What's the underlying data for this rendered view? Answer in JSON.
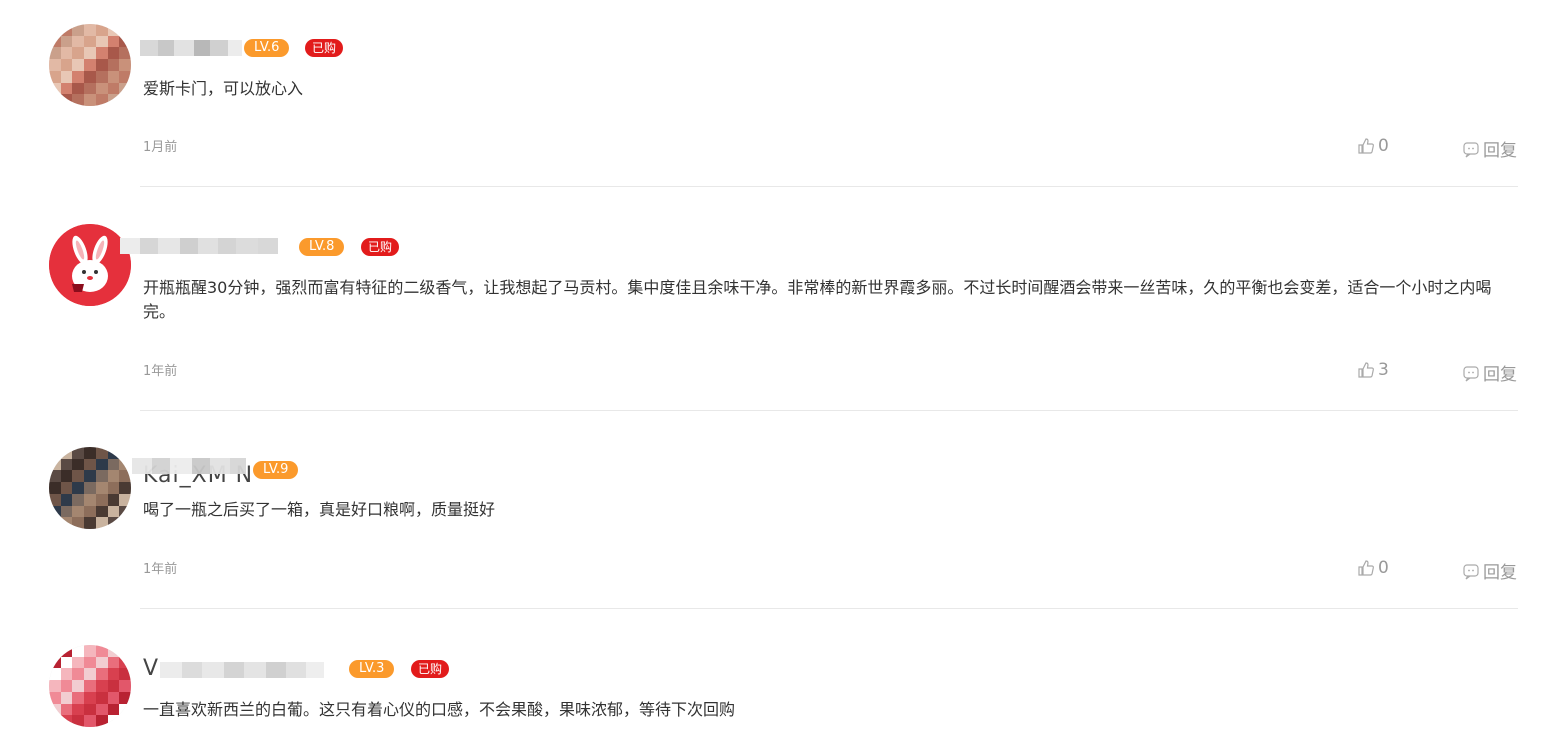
{
  "colors": {
    "level_badge": "#fb9a2c",
    "bought_badge": "#e21b1b",
    "meta_text": "#999999",
    "divider": "#e8e8e8"
  },
  "comments": [
    {
      "level": "LV.6",
      "bought": "已购",
      "text": "爱斯卡门，可以放心入",
      "time": "1月前",
      "likes": "0",
      "reply": "回复",
      "avatar_icon": "blurred-avatar-icon"
    },
    {
      "level": "LV.8",
      "bought": "已购",
      "text": "开瓶瓶醒30分钟，强烈而富有特征的二级香气，让我想起了马贡村。集中度佳且余味干净。非常棒的新世界霞多丽。不过长时间醒酒会带来一丝苦味，久的平衡也会变差，适合一个小时之内喝完。",
      "time": "1年前",
      "likes": "3",
      "reply": "回复",
      "avatar_icon": "rabbit-wine-avatar-icon"
    },
    {
      "name_partial": "Kai_XM N",
      "level": "LV.9",
      "text": "喝了一瓶之后买了一箱，真是好口粮啊，质量挺好",
      "time": "1年前",
      "likes": "0",
      "reply": "回复",
      "avatar_icon": "blurred-avatar-icon"
    },
    {
      "name_partial": "V",
      "level": "LV.3",
      "bought": "已购",
      "text": "一直喜欢新西兰的白葡。这只有着心仪的口感，不会果酸，果味浓郁，等待下次回购",
      "avatar_icon": "blurred-avatar-icon"
    }
  ]
}
